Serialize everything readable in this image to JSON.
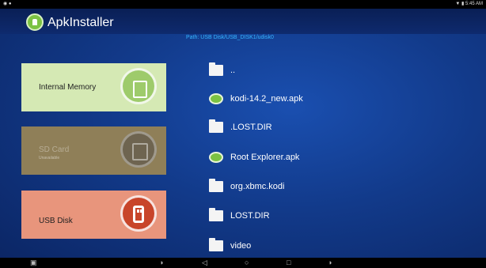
{
  "app": {
    "title": "ApkInstaller"
  },
  "status": {
    "left": "◉ ●",
    "right": "▼ ▮ 5:45 AM"
  },
  "path": "Path:  USB Disk/USB_DISK1/udisk0",
  "storage": [
    {
      "label": "Internal Memory",
      "sublabel": "",
      "icon": "storage-list-icon"
    },
    {
      "label": "SD Card",
      "sublabel": "Unavailable",
      "icon": "sd-card-icon"
    },
    {
      "label": "USB Disk",
      "sublabel": "",
      "icon": "usb-drive-icon"
    }
  ],
  "files": [
    {
      "name": "..",
      "type": "folder-up"
    },
    {
      "name": "kodi-14.2_new.apk",
      "type": "apk"
    },
    {
      "name": ".LOST.DIR",
      "type": "folder"
    },
    {
      "name": "Root Explorer.apk",
      "type": "apk"
    },
    {
      "name": "org.xbmc.kodi",
      "type": "folder"
    },
    {
      "name": "LOST.DIR",
      "type": "folder"
    },
    {
      "name": "video",
      "type": "folder"
    }
  ],
  "nav": {
    "screenshot": "▣",
    "vol_down": "◑",
    "back": "◁",
    "home": "○",
    "recents": "□",
    "vol_up": "◑"
  },
  "colors": {
    "background": "#1a4fb0",
    "path_text": "#36b6ff",
    "internal_card": "#d5e9b4",
    "sd_card": "#8f7f58",
    "usb_card": "#e8957c"
  }
}
